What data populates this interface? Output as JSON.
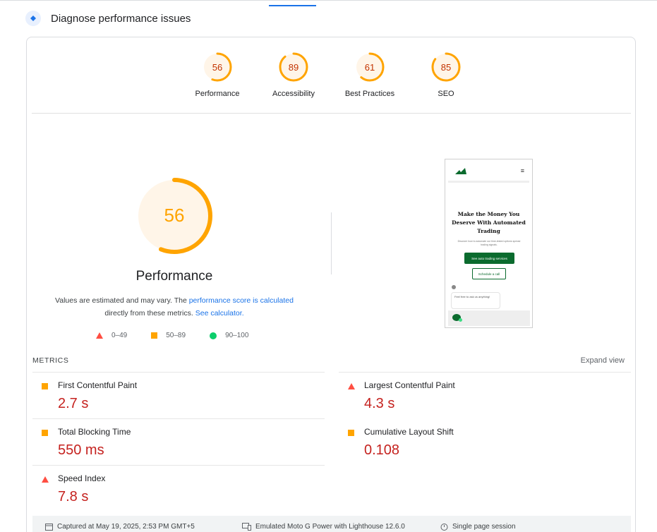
{
  "header": {
    "title": "Diagnose performance issues"
  },
  "categories": [
    {
      "label": "Performance",
      "score": 56
    },
    {
      "label": "Accessibility",
      "score": 89
    },
    {
      "label": "Best Practices",
      "score": 61
    },
    {
      "label": "SEO",
      "score": 85
    }
  ],
  "performance": {
    "score": "56",
    "title": "Performance",
    "desc_pre": "Values are estimated and may vary. The ",
    "desc_link1": "performance score is calculated",
    "desc_mid": "directly from these metrics. ",
    "desc_link2": "See calculator.",
    "legend": [
      {
        "range": "0–49",
        "shape": "triangle",
        "color": "#ff4e42"
      },
      {
        "range": "50–89",
        "shape": "square",
        "color": "#ffa400"
      },
      {
        "range": "90–100",
        "shape": "circle",
        "color": "#0cce6b"
      }
    ]
  },
  "preview": {
    "menu_icon": "≡",
    "headline": "Make the Money You Deserve With Automated Trading",
    "subtext": "Discover how to automate our time-tested options spread trading signals.",
    "button_primary": "See auto trading services",
    "button_secondary": "Schedule a call",
    "chat_text": "Feel free to ask us anything!"
  },
  "metrics": {
    "heading": "METRICS",
    "expand_label": "Expand view",
    "items": [
      {
        "name": "First Contentful Paint",
        "value": "2.7 s",
        "rating": "average"
      },
      {
        "name": "Largest Contentful Paint",
        "value": "4.3 s",
        "rating": "fail"
      },
      {
        "name": "Total Blocking Time",
        "value": "550 ms",
        "rating": "average"
      },
      {
        "name": "Cumulative Layout Shift",
        "value": "0.108",
        "rating": "average"
      },
      {
        "name": "Speed Index",
        "value": "7.8 s",
        "rating": "fail"
      }
    ]
  },
  "footer": {
    "captured": "Captured at May 19, 2025, 2:53 PM GMT+5",
    "device": "Emulated Moto G Power with Lighthouse 12.6.0",
    "session": "Single page session"
  },
  "colors": {
    "average": "#ffa400",
    "fail": "#ff4e42",
    "average_text": "#c33300",
    "value_red": "#c5221f",
    "link": "#1a73e8"
  }
}
